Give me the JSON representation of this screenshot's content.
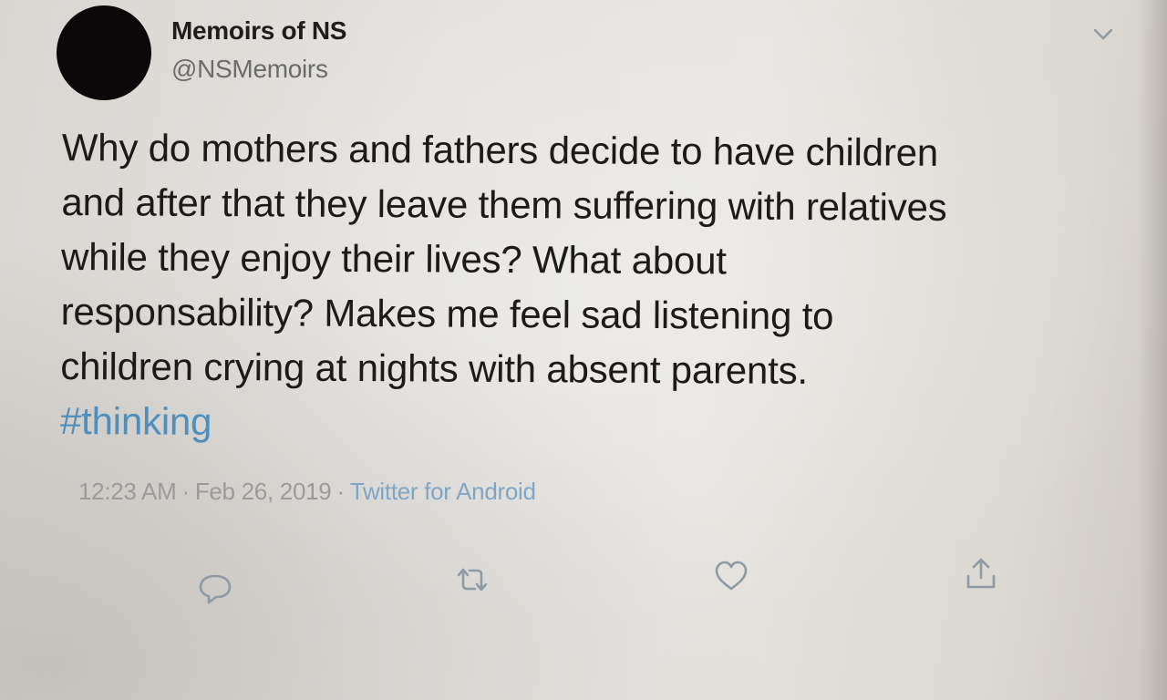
{
  "tweet": {
    "display_name": "Memoirs of NS",
    "handle": "@NSMemoirs",
    "text_lines": [
      "Why do mothers and fathers decide to have children",
      "and after that they leave them suffering with relatives",
      "while they enjoy their lives? What about",
      "responsability? Makes me feel sad listening to",
      "children crying at nights with absent parents."
    ],
    "hashtag": "#thinking",
    "time": "12:23 AM",
    "separator": "·",
    "date": "Feb 26, 2019",
    "source": "Twitter for Android"
  },
  "icons": {
    "menu": "chevron-down-icon",
    "reply": "reply-icon",
    "retweet": "retweet-icon",
    "like": "heart-icon",
    "share": "share-icon"
  },
  "colors": {
    "hashtag": "#4f8fbd",
    "source": "#7fa6c6",
    "icon_gray": "#8e9aa4"
  }
}
